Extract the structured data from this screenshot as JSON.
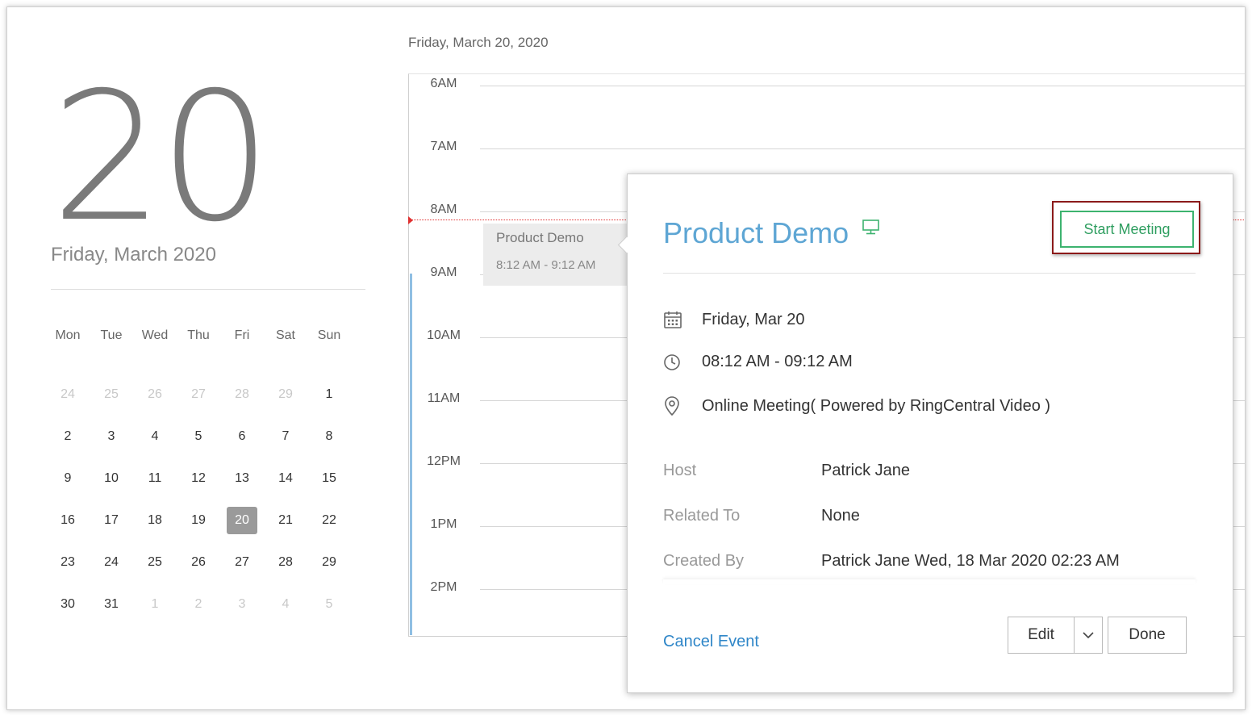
{
  "left_panel": {
    "big_day": "20",
    "month_label": "Friday, March 2020",
    "weekdays": [
      "Mon",
      "Tue",
      "Wed",
      "Thu",
      "Fri",
      "Sat",
      "Sun"
    ],
    "weeks": [
      [
        "24",
        "25",
        "26",
        "27",
        "28",
        "29",
        "1"
      ],
      [
        "2",
        "3",
        "4",
        "5",
        "6",
        "7",
        "8"
      ],
      [
        "9",
        "10",
        "11",
        "12",
        "13",
        "14",
        "15"
      ],
      [
        "16",
        "17",
        "18",
        "19",
        "20",
        "21",
        "22"
      ],
      [
        "23",
        "24",
        "25",
        "26",
        "27",
        "28",
        "29"
      ],
      [
        "30",
        "31",
        "1",
        "2",
        "3",
        "4",
        "5"
      ]
    ],
    "selected_day": "20"
  },
  "day_view": {
    "date_header": "Friday, March 20, 2020",
    "hours": [
      "6AM",
      "7AM",
      "8AM",
      "9AM",
      "10AM",
      "11AM",
      "12PM",
      "1PM",
      "2PM"
    ],
    "event": {
      "title": "Product Demo",
      "time": "8:12 AM - 9:12 AM"
    }
  },
  "popup": {
    "title": "Product Demo",
    "start_meeting_label": "Start Meeting",
    "date": "Friday, Mar 20",
    "time_range": "08:12 AM - 09:12 AM",
    "location": "Online Meeting( Powered by RingCentral Video )",
    "details": [
      {
        "label": "Host",
        "value": "Patrick Jane"
      },
      {
        "label": "Related To",
        "value": "None"
      },
      {
        "label": "Created By",
        "value": "Patrick Jane Wed, 18 Mar 2020 02:23 AM"
      }
    ],
    "cancel_label": "Cancel Event",
    "edit_label": "Edit",
    "done_label": "Done"
  },
  "colors": {
    "title_blue": "#5ea6d4",
    "start_green": "#3db36f",
    "highlight_border": "#8b1a1a",
    "link_blue": "#2f86c8",
    "now_red": "#e03030"
  },
  "icons": {
    "meeting": "monitor-icon",
    "date": "calendar-icon",
    "time": "clock-icon",
    "location": "map-pin-icon",
    "edit_dropdown": "chevron-down-icon"
  }
}
